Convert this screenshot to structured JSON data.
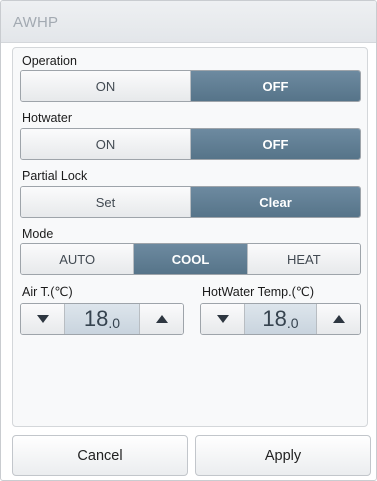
{
  "window": {
    "title": "AWHP"
  },
  "operation": {
    "label": "Operation",
    "options": [
      "ON",
      "OFF"
    ],
    "selected": "OFF"
  },
  "hotwater": {
    "label": "Hotwater",
    "options": [
      "ON",
      "OFF"
    ],
    "selected": "OFF"
  },
  "partial_lock": {
    "label": "Partial Lock",
    "options": [
      "Set",
      "Clear"
    ],
    "selected": "Clear"
  },
  "mode": {
    "label": "Mode",
    "options": [
      "AUTO",
      "COOL",
      "HEAT"
    ],
    "selected": "COOL"
  },
  "air_temp": {
    "label": "Air T.(℃)",
    "value_int": "18",
    "value_dec": ".0"
  },
  "hotwater_temp": {
    "label": "HotWater Temp.(℃)",
    "value_int": "18",
    "value_dec": ".0"
  },
  "icons": {
    "decrease": "triangle-down-icon",
    "increase": "triangle-up-icon"
  },
  "colors": {
    "selected": "#5f7d93",
    "unselected": "#eef0f2",
    "title_text": "#a3aab2"
  },
  "buttons": {
    "cancel": "Cancel",
    "apply": "Apply"
  }
}
